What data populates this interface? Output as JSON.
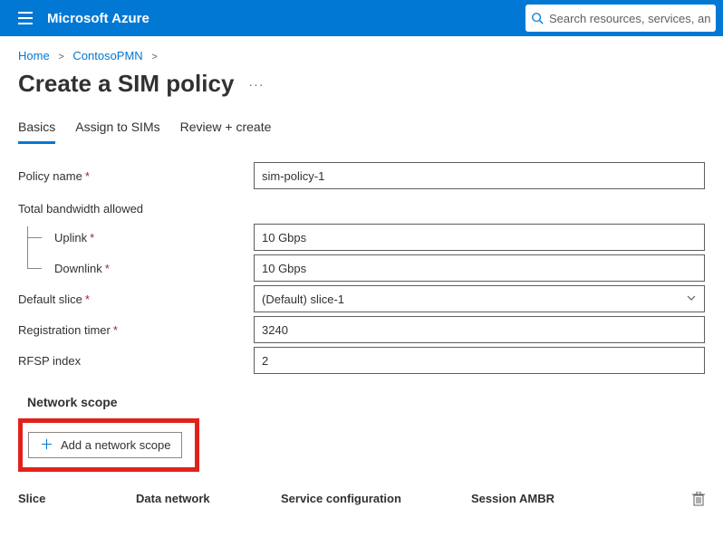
{
  "topbar": {
    "brand": "Microsoft Azure",
    "search_placeholder": "Search resources, services, and docs"
  },
  "breadcrumb": {
    "items": [
      "Home",
      "ContosoPMN"
    ]
  },
  "page": {
    "title": "Create a SIM policy"
  },
  "tabs": [
    {
      "label": "Basics",
      "active": true
    },
    {
      "label": "Assign to SIMs",
      "active": false
    },
    {
      "label": "Review + create",
      "active": false
    }
  ],
  "form": {
    "policy_name_label": "Policy name",
    "policy_name_value": "sim-policy-1",
    "bandwidth_group_label": "Total bandwidth allowed",
    "uplink_label": "Uplink",
    "uplink_value": "10 Gbps",
    "downlink_label": "Downlink",
    "downlink_value": "10 Gbps",
    "default_slice_label": "Default slice",
    "default_slice_value": "(Default) slice-1",
    "registration_timer_label": "Registration timer",
    "registration_timer_value": "3240",
    "rfsp_index_label": "RFSP index",
    "rfsp_index_value": "2"
  },
  "section": {
    "network_scope_heading": "Network scope",
    "add_button_label": "Add a network scope"
  },
  "table": {
    "col_slice": "Slice",
    "col_data_network": "Data network",
    "col_service_config": "Service configuration",
    "col_session_ambr": "Session AMBR"
  }
}
